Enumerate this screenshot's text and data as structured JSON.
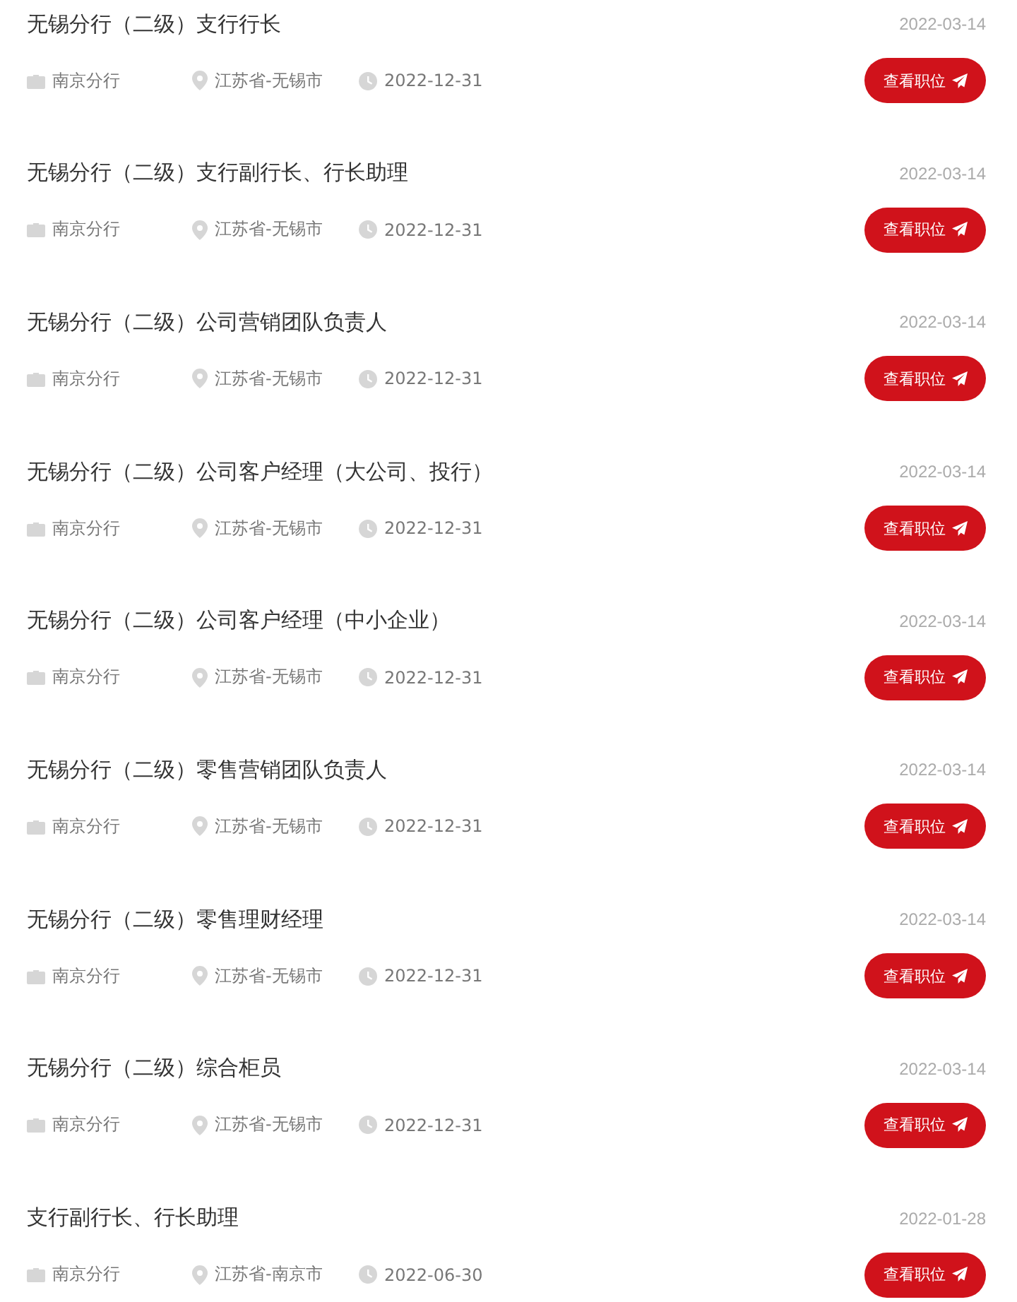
{
  "jobs": [
    {
      "title": "无锡分行（二级）支行行长",
      "date": "2022-03-14",
      "branch": "南京分行",
      "location": "江苏省-无锡市",
      "deadline": "2022-12-31",
      "button": "查看职位"
    },
    {
      "title": "无锡分行（二级）支行副行长、行长助理",
      "date": "2022-03-14",
      "branch": "南京分行",
      "location": "江苏省-无锡市",
      "deadline": "2022-12-31",
      "button": "查看职位"
    },
    {
      "title": "无锡分行（二级）公司营销团队负责人",
      "date": "2022-03-14",
      "branch": "南京分行",
      "location": "江苏省-无锡市",
      "deadline": "2022-12-31",
      "button": "查看职位"
    },
    {
      "title": "无锡分行（二级）公司客户经理（大公司、投行）",
      "date": "2022-03-14",
      "branch": "南京分行",
      "location": "江苏省-无锡市",
      "deadline": "2022-12-31",
      "button": "查看职位"
    },
    {
      "title": "无锡分行（二级）公司客户经理（中小企业）",
      "date": "2022-03-14",
      "branch": "南京分行",
      "location": "江苏省-无锡市",
      "deadline": "2022-12-31",
      "button": "查看职位"
    },
    {
      "title": "无锡分行（二级）零售营销团队负责人",
      "date": "2022-03-14",
      "branch": "南京分行",
      "location": "江苏省-无锡市",
      "deadline": "2022-12-31",
      "button": "查看职位"
    },
    {
      "title": "无锡分行（二级）零售理财经理",
      "date": "2022-03-14",
      "branch": "南京分行",
      "location": "江苏省-无锡市",
      "deadline": "2022-12-31",
      "button": "查看职位"
    },
    {
      "title": "无锡分行（二级）综合柜员",
      "date": "2022-03-14",
      "branch": "南京分行",
      "location": "江苏省-无锡市",
      "deadline": "2022-12-31",
      "button": "查看职位"
    },
    {
      "title": "支行副行长、行长助理",
      "date": "2022-01-28",
      "branch": "南京分行",
      "location": "江苏省-南京市",
      "deadline": "2022-06-30",
      "button": "查看职位"
    }
  ]
}
